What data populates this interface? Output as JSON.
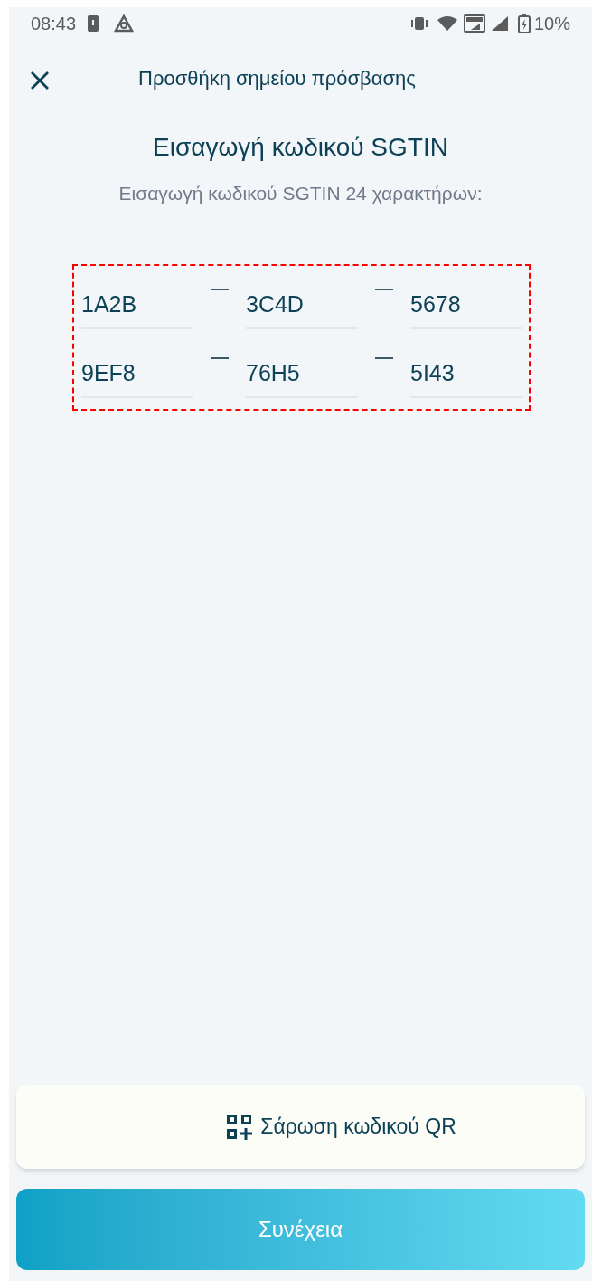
{
  "status_bar": {
    "time": "08:43",
    "battery": "10%"
  },
  "header": {
    "title": "Προσθήκη σημείου πρόσβασης"
  },
  "heading": "Εισαγωγή κωδικού SGTIN",
  "subheading": "Εισαγωγή κωδικού SGTIN 24 χαρακτήρων:",
  "code_rows": [
    {
      "fields": [
        {
          "value": "1A2B"
        },
        {
          "value": "3C4D"
        },
        {
          "value": "5678"
        }
      ]
    },
    {
      "fields": [
        {
          "value": "9EF8"
        },
        {
          "value": "76H5"
        },
        {
          "value": "5I43"
        }
      ]
    }
  ],
  "scan_button": {
    "label": "Σάρωση κωδικού QR"
  },
  "continue_button": {
    "label": "Συνέχεια"
  }
}
